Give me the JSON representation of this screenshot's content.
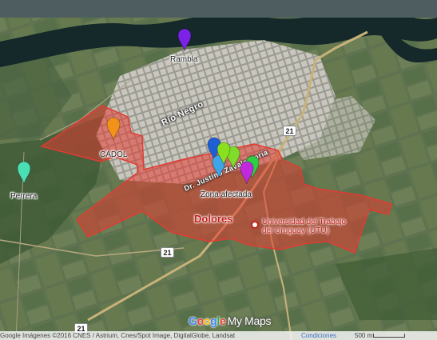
{
  "map": {
    "city_label": "Dolores",
    "river_label": "Río Negro",
    "street_label": "Dr. Justino Zavala Soria",
    "poi_label": "Universidad del Trabajo del Uruguay (UTU)",
    "route_number": "21",
    "markers": [
      {
        "label": "Rambla",
        "color": "#7a22e6",
        "labeled": true
      },
      {
        "label": "CADOL",
        "color": "#f2921b",
        "labeled": true
      },
      {
        "label": "Perrera",
        "color": "#4be0b4",
        "labeled": true
      },
      {
        "label": "Zona afectada",
        "color": "#1f5fd6",
        "labeled": true
      },
      {
        "label": "",
        "color": "#7fdc2a",
        "labeled": false
      },
      {
        "label": "",
        "color": "#3ea6e8",
        "labeled": false
      },
      {
        "label": "",
        "color": "#2fce45",
        "labeled": false
      },
      {
        "label": "",
        "color": "#c229de",
        "labeled": false
      },
      {
        "label": "",
        "color": "#89e021",
        "labeled": false
      }
    ],
    "affected_area_color": "#e23b32"
  },
  "footer": {
    "attribution": "Google Imágenes ©2016 CNES / Astrium, Cnes/Spot Image, DigitalGlobe, Landsat",
    "terms_link": "Condiciones",
    "scale_label": "500 m",
    "logo_google": [
      "G",
      "o",
      "o",
      "g",
      "l",
      "e"
    ],
    "logo_suffix": "My Maps"
  }
}
